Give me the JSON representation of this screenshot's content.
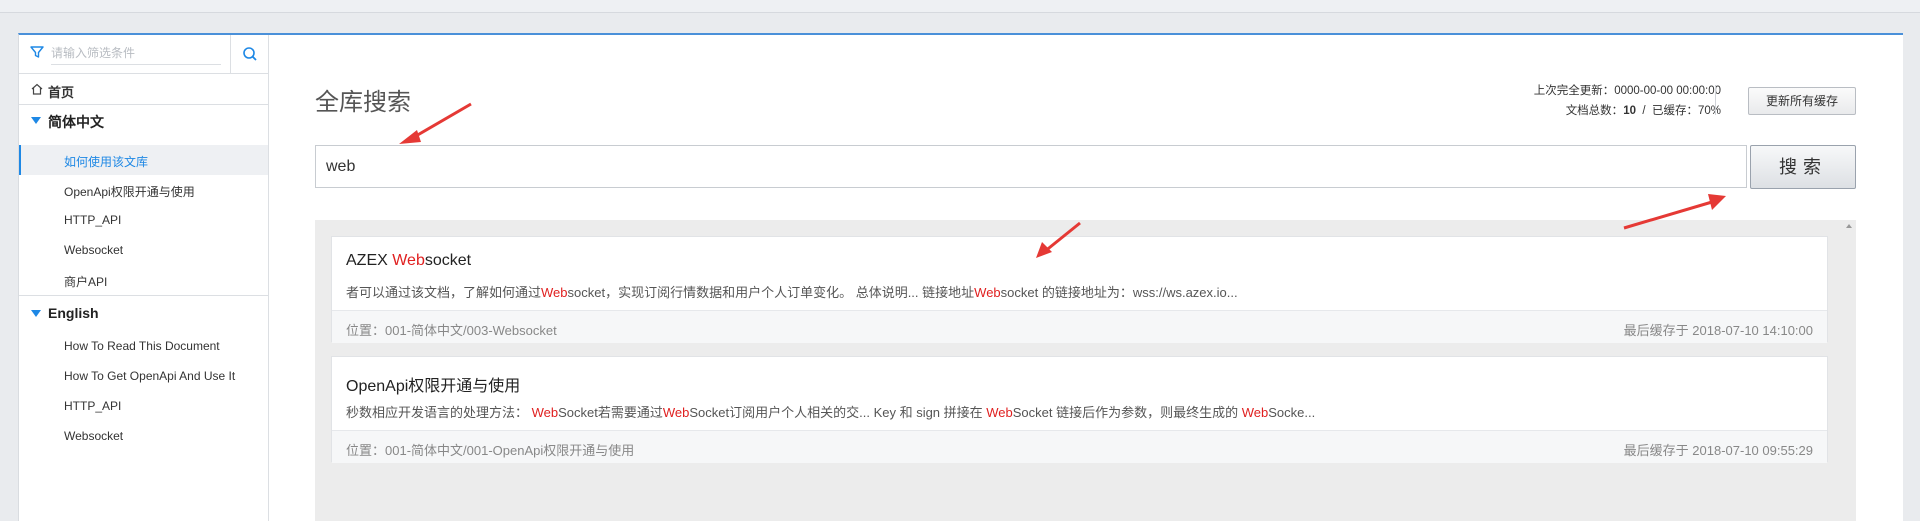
{
  "sidebar": {
    "filter_placeholder": "请输入筛选条件",
    "home_label": "首页",
    "groups": [
      {
        "label": "简体中文",
        "items": [
          {
            "label": "如何使用该文库",
            "active": true
          },
          {
            "label": "OpenApi权限开通与使用"
          },
          {
            "label": "HTTP_API"
          },
          {
            "label": "Websocket"
          },
          {
            "label": "商户API"
          }
        ]
      },
      {
        "label": "English",
        "items": [
          {
            "label": "How To Read This Document"
          },
          {
            "label": "How To Get OpenApi And Use It"
          },
          {
            "label": "HTTP_API"
          },
          {
            "label": "Websocket"
          }
        ]
      }
    ]
  },
  "main": {
    "title": "全库搜索",
    "meta": {
      "last_update_label": "上次完全更新：",
      "last_update_value": "0000-00-00 00:00:00",
      "doc_total_label": "文档总数：",
      "doc_total_value": "10",
      "separator": "/",
      "cached_label": "已缓存：",
      "cached_value": "70%"
    },
    "refresh_button": "更新所有缓存",
    "search_value": "web",
    "search_button": "搜索",
    "results": [
      {
        "title_pre": "AZEX ",
        "title_hl": "Web",
        "title_post": "socket",
        "snippet": [
          {
            "t": "者可以通过该文档，了解如何通过"
          },
          {
            "t": "Web",
            "hl": true
          },
          {
            "t": "socket，实现订阅行情数据和用户个人订单变化。 总体说明... 链接地址"
          },
          {
            "t": "Web",
            "hl": true
          },
          {
            "t": "socket 的链接地址为：wss://ws.azex.io..."
          }
        ],
        "location": "位置：001-简体中文/003-Websocket",
        "cached_at": "最后缓存于 2018-07-10 14:10:00"
      },
      {
        "title_pre": "OpenApi权限开通与使用",
        "title_hl": "",
        "title_post": "",
        "snippet": [
          {
            "t": "秒数相应开发语言的处理方法： "
          },
          {
            "t": "Web",
            "hl": true
          },
          {
            "t": "Socket若需要通过"
          },
          {
            "t": "Web",
            "hl": true
          },
          {
            "t": "Socket订阅用户个人相关的交... Key 和 sign 拼接在 "
          },
          {
            "t": "Web",
            "hl": true
          },
          {
            "t": "Socket 链接后作为参数，则最终生成的 "
          },
          {
            "t": "Web",
            "hl": true
          },
          {
            "t": "Socke..."
          }
        ],
        "location": "位置：001-简体中文/001-OpenApi权限开通与使用",
        "cached_at": "最后缓存于 2018-07-10 09:55:29"
      }
    ]
  },
  "colors": {
    "accent": "#1e88e5",
    "highlight": "#e02020",
    "annotation_arrow": "#e53935"
  }
}
